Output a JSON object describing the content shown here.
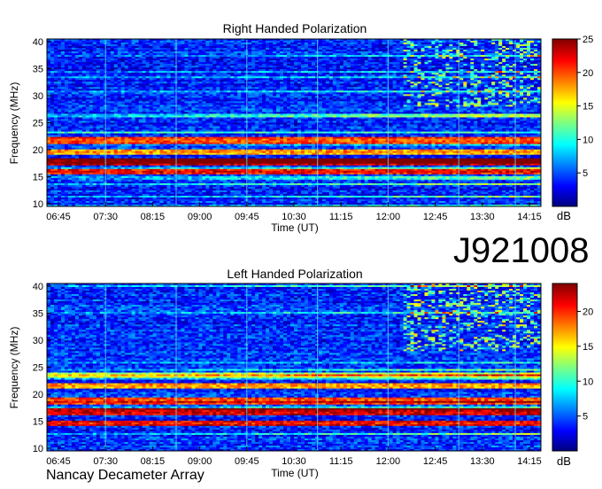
{
  "chart_data": [
    {
      "type": "heatmap",
      "title": "Right Handed Polarization",
      "xlabel": "Time (UT)",
      "ylabel": "Frequency (MHz)",
      "x_ticks": [
        "06:45",
        "07:30",
        "08:15",
        "09:00",
        "09:45",
        "10:30",
        "11:15",
        "12:00",
        "12:45",
        "13:30",
        "14:15"
      ],
      "y_ticks": [
        10,
        15,
        20,
        25,
        30,
        35,
        40
      ],
      "ylim": [
        9.5,
        40.5
      ],
      "colorbar": {
        "label": "dB",
        "ticks": [
          5,
          10,
          15,
          20,
          25
        ],
        "range": [
          0,
          25
        ]
      },
      "colormap": "jet",
      "grid": false,
      "emission_bands_mhz": [
        [
          15.5,
          16.5,
          23
        ],
        [
          17,
          18.5,
          24
        ],
        [
          19,
          20,
          19
        ],
        [
          21,
          22.5,
          21
        ],
        [
          23,
          23.5,
          12
        ]
      ]
    },
    {
      "type": "heatmap",
      "title": "Left Handed Polarization",
      "xlabel": "Time (UT)",
      "ylabel": "Frequency (MHz)",
      "x_ticks": [
        "06:45",
        "07:30",
        "08:15",
        "09:00",
        "09:45",
        "10:30",
        "11:15",
        "12:00",
        "12:45",
        "13:30",
        "14:15"
      ],
      "y_ticks": [
        10,
        15,
        20,
        25,
        30,
        35,
        40
      ],
      "ylim": [
        9.5,
        40.5
      ],
      "colorbar": {
        "label": "dB",
        "ticks": [
          5,
          10,
          15,
          20
        ],
        "range": [
          0,
          24
        ]
      },
      "colormap": "jet",
      "grid": false,
      "emission_bands_mhz": [
        [
          14,
          15,
          22
        ],
        [
          16,
          17.5,
          23
        ],
        [
          18,
          19.5,
          20
        ],
        [
          21,
          22,
          18
        ],
        [
          23,
          24,
          14
        ]
      ]
    }
  ],
  "observation_id": "J921008",
  "instrument": "Nancay Decameter Array",
  "colors": {
    "background": "#ffffff",
    "text": "#000000"
  }
}
